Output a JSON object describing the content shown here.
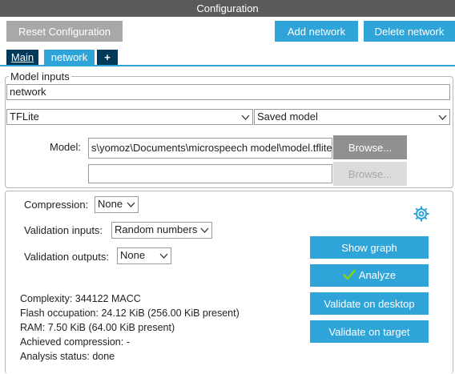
{
  "title": "Configuration",
  "toolbar": {
    "reset": "Reset Configuration",
    "add_network": "Add network",
    "delete_network": "Delete network"
  },
  "tabs": {
    "main": "Main",
    "network": "network",
    "add": "+"
  },
  "model_inputs": {
    "legend": "Model inputs",
    "name": "network",
    "framework": "TFLite",
    "model_type": "Saved model",
    "model_label": "Model:",
    "model_path": "s\\yomoz\\Documents\\microspeech model\\model.tflite",
    "browse": "Browse...",
    "second_path": "",
    "browse2": "Browse..."
  },
  "settings": {
    "compression_label": "Compression:",
    "compression_value": "None",
    "val_inputs_label": "Validation inputs:",
    "val_inputs_value": "Random numbers",
    "val_outputs_label": "Validation outputs:",
    "val_outputs_value": "None"
  },
  "actions": {
    "show_graph": "Show graph",
    "analyze": "Analyze",
    "validate_desktop": "Validate on desktop",
    "validate_target": "Validate on target"
  },
  "analysis": {
    "complexity": "Complexity:  344122 MACC",
    "flash": "Flash occupation: 24.12 KiB (256.00 KiB present)",
    "ram": "RAM: 7.50 KiB (64.00 KiB present)",
    "compression": "Achieved compression: -",
    "status": "Analysis status: done"
  },
  "icons": {
    "settings": "gear-icon",
    "analyze_check": "check-icon",
    "dropdown": "chevron-down-icon"
  },
  "colors": {
    "accent": "#2fa4d8",
    "dark_tab": "#003a5a",
    "title_bar": "#5a5a5a"
  }
}
